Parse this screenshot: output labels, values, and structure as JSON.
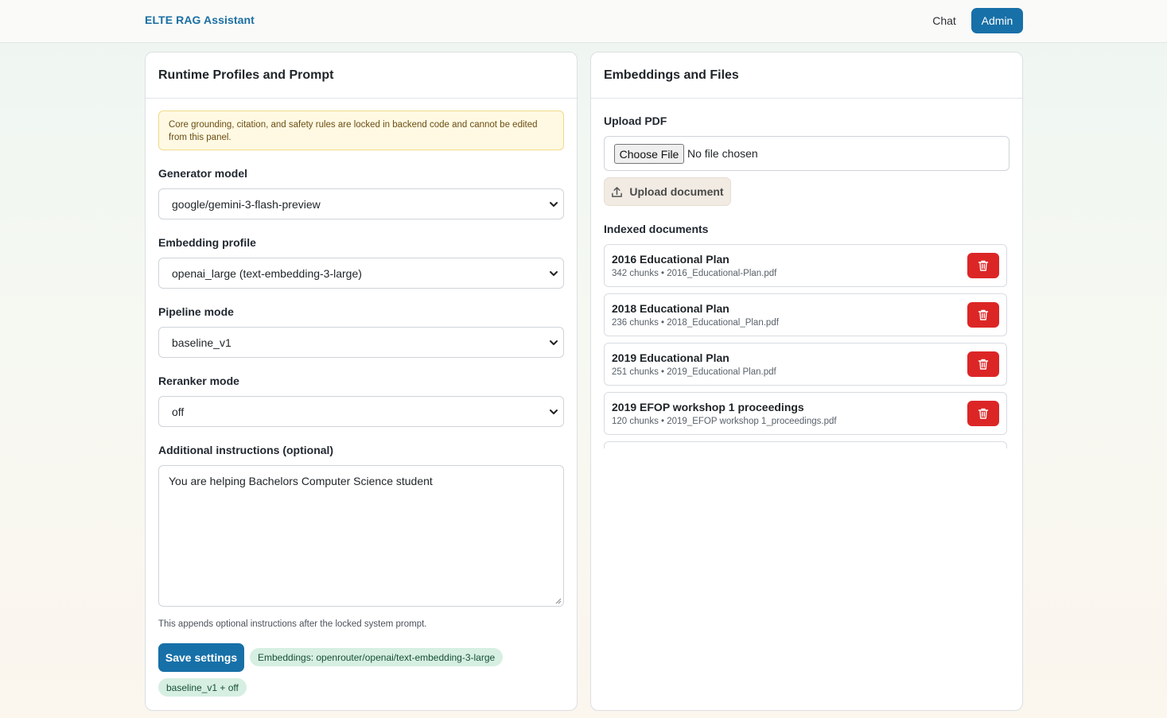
{
  "header": {
    "brand": "ELTE RAG Assistant",
    "nav": {
      "chat": "Chat",
      "admin": "Admin"
    }
  },
  "left_panel": {
    "title": "Runtime Profiles and Prompt",
    "alert": "Core grounding, citation, and safety rules are locked in backend code and cannot be edited from this panel.",
    "generator_model": {
      "label": "Generator model",
      "value": "google/gemini-3-flash-preview"
    },
    "embedding_profile": {
      "label": "Embedding profile",
      "value": "openai_large (text-embedding-3-large)"
    },
    "pipeline_mode": {
      "label": "Pipeline mode",
      "value": "baseline_v1"
    },
    "reranker_mode": {
      "label": "Reranker mode",
      "value": "off"
    },
    "instructions": {
      "label": "Additional instructions (optional)",
      "value": "You are helping Bachelors Computer Science student",
      "help": "This appends optional instructions after the locked system prompt."
    },
    "save_label": "Save settings",
    "badges": {
      "embeddings": "Embeddings: openrouter/openai/text-embedding-3-large",
      "pipeline": "baseline_v1 + off"
    }
  },
  "right_panel": {
    "title": "Embeddings and Files",
    "upload_label": "Upload PDF",
    "choose_file": "Choose File",
    "no_file": "No file chosen",
    "upload_button": "Upload document",
    "indexed_label": "Indexed documents",
    "documents": [
      {
        "title": "2016 Educational Plan",
        "meta": "342 chunks • 2016_Educational-Plan.pdf"
      },
      {
        "title": "2018 Educational Plan",
        "meta": "236 chunks • 2018_Educational_Plan.pdf"
      },
      {
        "title": "2019 Educational Plan",
        "meta": "251 chunks • 2019_Educational Plan.pdf"
      },
      {
        "title": "2019 EFOP workshop 1 proceedings",
        "meta": "120 chunks • 2019_EFOP workshop 1_proceedings.pdf"
      }
    ]
  },
  "colors": {
    "primary": "#1770a8",
    "danger": "#dc2626",
    "badge_bg": "#d6efe2",
    "alert_bg": "#fff9e3"
  },
  "icons": {
    "select_arrow": "chevron-down-icon",
    "upload": "upload-icon",
    "delete": "trash-icon"
  }
}
